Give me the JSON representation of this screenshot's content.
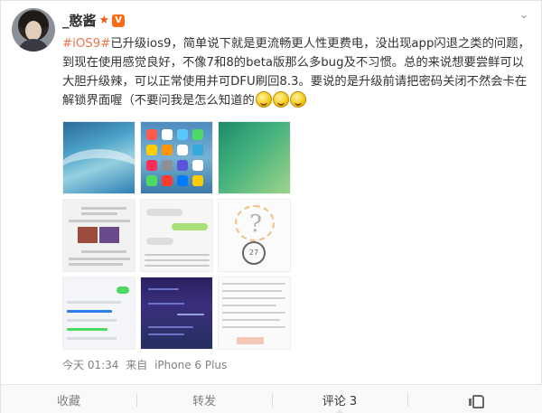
{
  "post": {
    "username": "_憨酱",
    "member_badge": "V",
    "text_topic": "#iOS9#",
    "text_body": "已升级ios9，简单说下就是更流畅更人性更费电，没出现app闪退之类的问题，到现在使用感觉良好，不像7和8的beta版那么多bug及不习惯。总的来说想要尝鲜可以大胆升级辣，可以正常使用并可DFU刷回8.3。要说的是升级前请把密码关闭不然会卡在解锁界面喔（不要问我是怎么知道的",
    "emoji_names": [
      "smile-emoji",
      "smile-emoji",
      "smile-emoji"
    ],
    "time": "今天 01:34",
    "source_prefix": "来自",
    "source": "iPhone 6 Plus",
    "thumb_clock_label": "27"
  },
  "actions": {
    "favorite": "收藏",
    "repost": "转发",
    "comment": "评论 3"
  },
  "colors": {
    "topic": "#eb7350",
    "username": "#333333",
    "meta": "#808080"
  }
}
